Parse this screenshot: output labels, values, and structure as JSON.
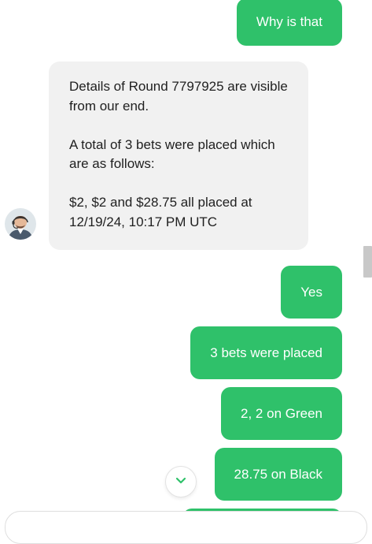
{
  "messages": [
    {
      "from": "user",
      "text": "Why is that"
    },
    {
      "from": "agent",
      "paragraphs": [
        "Details of Round 7797925 are visible from our end.",
        "A total of 3 bets were placed which are as follows:",
        "$2, $2 and $28.75 all placed at 12/19/24, 10:17 PM UTC"
      ]
    },
    {
      "from": "user",
      "text": "Yes"
    },
    {
      "from": "user",
      "text": "3 bets were placed"
    },
    {
      "from": "user",
      "text": "2, 2 on Green"
    },
    {
      "from": "user",
      "text": "28.75 on Black"
    }
  ],
  "icons": {
    "agent_avatar": "agent-avatar",
    "scroll_down": "chevron-down-icon"
  },
  "colors": {
    "user_bubble": "#2fc16a",
    "agent_bubble": "#f1f1f1",
    "accent": "#2fc16a"
  }
}
